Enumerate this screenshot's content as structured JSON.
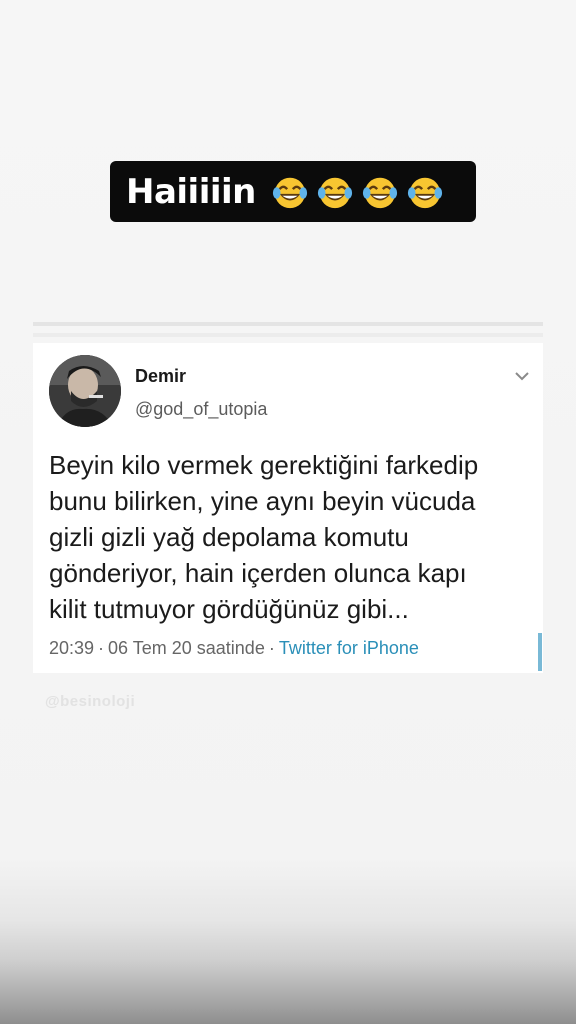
{
  "story": {
    "caption": "Haiiiiin",
    "caption_emoji_count": 4,
    "caption_emoji": "face-with-tears-of-joy-icon"
  },
  "tweet": {
    "name": "Demir",
    "handle": "@god_of_utopia",
    "body_lines": [
      "Beyin kilo vermek gerektiğini farkedip",
      "bunu bilirken, yine aynı beyin vücuda",
      "gizli gizli yağ depolama komutu",
      "gönderiyor, hain içerden olunca kapı",
      "kilit tutmuyor gördüğünüz gibi..."
    ],
    "time": "20:39",
    "date": "06 Tem 20 saatinde",
    "source": "Twitter for iPhone",
    "separator": "·",
    "source_color": "#2a8fb8"
  },
  "watermark": "@besinoloji"
}
